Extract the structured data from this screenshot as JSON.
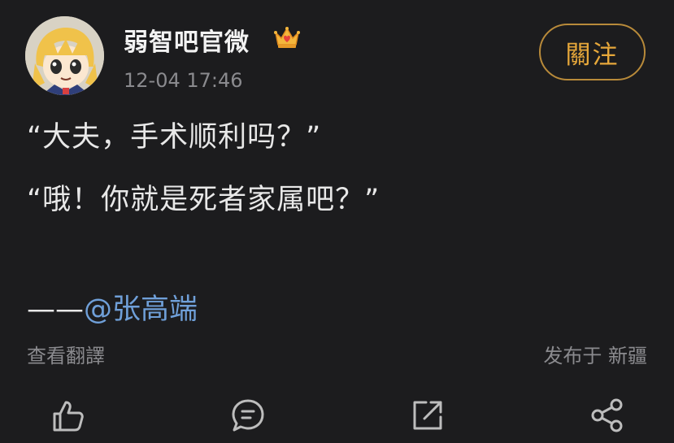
{
  "post": {
    "author": {
      "name": "弱智吧官微",
      "badge_icon": "crown-icon",
      "avatar_icon": "cartoon-girl-avatar"
    },
    "timestamp": "12-04 17:46",
    "follow_label": "關注",
    "lines": [
      "“大夫，手术顺利吗？”",
      "“哦！你就是死者家属吧？”"
    ],
    "signature": {
      "dash": "——",
      "mention": "@张高端"
    },
    "translate_label": "查看翻譯",
    "location": "发布于 新疆"
  },
  "actions": [
    {
      "icon": "like-icon"
    },
    {
      "icon": "comment-icon"
    },
    {
      "icon": "repost-icon"
    },
    {
      "icon": "share-icon"
    }
  ],
  "colors": {
    "background": "#1c1c1e",
    "accent": "#e6a73a",
    "mention": "#6f9fd8",
    "muted": "#8a8a8e"
  }
}
